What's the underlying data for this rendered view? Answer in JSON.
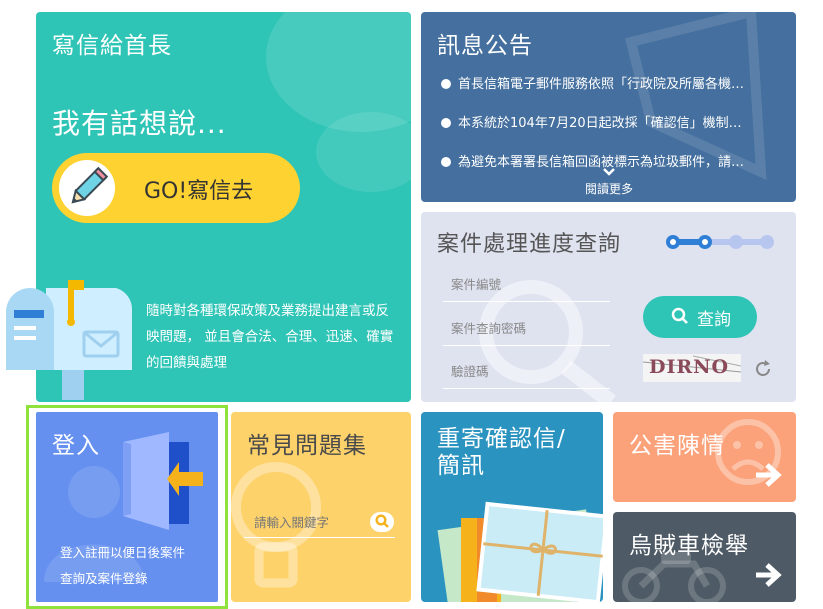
{
  "write": {
    "title": "寫信給首長",
    "subhead": "我有話想說...",
    "go_label": "GO!寫信去",
    "desc": "隨時對各種環保政策及業務提出建言或反映問題， 並且會合法、合理、迅速、確實的回饋與處理"
  },
  "news": {
    "title": "訊息公告",
    "items": [
      "首長信箱電子郵件服務依照「行政院及所屬各機…",
      "本系統於104年7月20日起改採「確認信」機制…",
      "為避免本署署長信箱回函被標示為垃圾郵件，請…"
    ],
    "more": "閱讀更多"
  },
  "query": {
    "title": "案件處理進度查詢",
    "case_no_placeholder": "案件編號",
    "password_placeholder": "案件查詢密碼",
    "captcha_placeholder": "驗證碼",
    "search_label": "查詢",
    "captcha_text": "DIRNO"
  },
  "login": {
    "title": "登入",
    "desc_line1": "登入註冊以便日後案件",
    "desc_line2": "查詢及案件登錄"
  },
  "faq": {
    "title": "常見問題集",
    "placeholder": "請輸入關鍵字"
  },
  "resend": {
    "title_line1": "重寄確認信/",
    "title_line2": "簡訊"
  },
  "complaint": {
    "title": "公害陳情"
  },
  "car": {
    "title": "烏賊車檢舉"
  },
  "colors": {
    "teal": "#2ec4b6",
    "navy": "#446f9e",
    "lavender": "#dfe3f0",
    "blue": "#6590f0",
    "yellow": "#fdd26b",
    "ocean": "#2b93c0",
    "salmon": "#fba27a",
    "slate": "#4e5a65",
    "highlight": "#8fe13b"
  }
}
